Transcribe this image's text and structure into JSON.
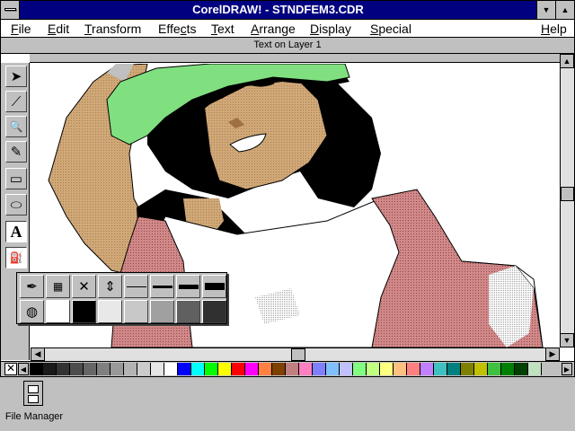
{
  "window": {
    "title": "CorelDRAW! - STNDFEM3.CDR",
    "minimize_glyph": "▼",
    "maximize_glyph": "▲"
  },
  "menu": {
    "items": [
      {
        "label": "File",
        "accel": "F",
        "rest": "ile"
      },
      {
        "label": "Edit",
        "accel": "E",
        "rest": "dit"
      },
      {
        "label": "Transform",
        "accel": "T",
        "rest": "ransform"
      },
      {
        "label": "Effects",
        "accel": "c",
        "pre": "Effe",
        "rest": "ts"
      },
      {
        "label": "Text",
        "accel": "T",
        "rest": "ext"
      },
      {
        "label": "Arrange",
        "accel": "A",
        "rest": "rrange"
      },
      {
        "label": "Display",
        "accel": "D",
        "rest": "isplay"
      },
      {
        "label": "Special",
        "accel": "S",
        "rest": "pecial"
      },
      {
        "label": "Help",
        "accel": "H",
        "rest": "elp"
      }
    ]
  },
  "status": {
    "text": "Text on Layer 1"
  },
  "toolbox": {
    "tools": [
      {
        "name": "pick-tool",
        "icon": "arrow-pointer-icon",
        "glyph": "➤"
      },
      {
        "name": "shape-tool",
        "icon": "shape-node-icon",
        "glyph": "⟋"
      },
      {
        "name": "zoom-tool",
        "icon": "magnifier-icon",
        "glyph": "🔍"
      },
      {
        "name": "pencil-tool",
        "icon": "pencil-icon",
        "glyph": "✎"
      },
      {
        "name": "rectangle-tool",
        "icon": "rectangle-icon",
        "glyph": "▭"
      },
      {
        "name": "ellipse-tool",
        "icon": "ellipse-icon",
        "glyph": "⬭"
      },
      {
        "name": "text-tool",
        "icon": "text-a-icon",
        "glyph": "A"
      },
      {
        "name": "fill-tool",
        "icon": "paint-bucket-icon",
        "glyph": "⛽"
      }
    ]
  },
  "outline_flyout": {
    "row1_icons": [
      "outline-pen-icon",
      "outline-color-dialog-icon",
      "no-outline-x-icon",
      "hairline-icon",
      "thin-line-icon",
      "medium-line-icon",
      "thick-line-icon",
      "thickest-line-icon"
    ],
    "row2_icons": [
      "color-wheel-icon",
      "white-outline-icon",
      "black-outline-icon",
      "gray-10-icon",
      "gray-30-icon",
      "gray-50-icon",
      "gray-70-icon",
      "gray-90-icon"
    ],
    "x_glyph": "✕",
    "hair_glyph": "⇕"
  },
  "palette": {
    "no_color_glyph": "✕",
    "left_arrow": "◀",
    "right_arrow": "▶",
    "colors": [
      "#000000",
      "#1a1a1a",
      "#333333",
      "#4d4d4d",
      "#666666",
      "#808080",
      "#999999",
      "#b3b3b3",
      "#cccccc",
      "#e6e6e6",
      "#ffffff",
      "#0000ff",
      "#00ffff",
      "#00ff00",
      "#ffff00",
      "#ff0000",
      "#ff00ff",
      "#ff8040",
      "#804000",
      "#c08080",
      "#ff80c0",
      "#8080ff",
      "#80c0ff",
      "#c0c0ff",
      "#80ff80",
      "#c0ff80",
      "#ffff80",
      "#ffc080",
      "#ff8080",
      "#c080ff",
      "#40c0c0",
      "#008080",
      "#808000",
      "#c0c000",
      "#40c040",
      "#008000",
      "#004000",
      "#c0e0c0"
    ]
  },
  "desktop": {
    "icon_label": "File Manager"
  },
  "colors": {
    "title_bar": "#000080",
    "skin": "#c8a070",
    "skin_light": "#e0b890",
    "cap": "#80e080",
    "hair": "#000000",
    "jacket": "#c07878"
  }
}
